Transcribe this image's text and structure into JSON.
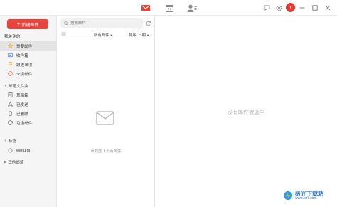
{
  "colors": {
    "accent": "#e5433b",
    "sidebar_bg": "#f5f5f5",
    "active_bg": "#e4e4e4"
  },
  "topbar": {
    "icons": [
      "mail-icon",
      "calendar-icon",
      "contacts-icon",
      "chat-icon",
      "settings-icon",
      "avatar",
      "minimize-icon",
      "maximize-icon",
      "close-icon"
    ],
    "avatar_letter": "Y"
  },
  "sidebar": {
    "compose_label": "新建邮件",
    "favorites_title": "我关注的",
    "favorites": [
      {
        "label": "重要邮件",
        "icon": "star-icon",
        "active": true
      },
      {
        "label": "收件箱",
        "icon": "inbox-icon",
        "active": false
      },
      {
        "label": "跟进事项",
        "icon": "flag-icon",
        "active": false
      },
      {
        "label": "未读邮件",
        "icon": "unread-icon",
        "active": false
      }
    ],
    "folders_title": "邮箱文件夹",
    "folders": [
      {
        "label": "草稿箱",
        "icon": "draft-icon"
      },
      {
        "label": "已发送",
        "icon": "sent-icon"
      },
      {
        "label": "已删除",
        "icon": "trash-icon"
      },
      {
        "label": "垃圾邮件",
        "icon": "spam-icon"
      }
    ],
    "tags_title": "标签",
    "tags": [
      {
        "label": "weifu dj",
        "icon": "tag-icon"
      }
    ],
    "other_title": "其他邮箱"
  },
  "list": {
    "search_placeholder": "搜索邮件",
    "filter_all": "所有邮件",
    "sort_label": "排序:",
    "sort_value": "日期",
    "empty_text": "该视图下没有邮件"
  },
  "pane": {
    "empty_text": "没有邮件被选中"
  },
  "watermark": {
    "text": "极光下载站",
    "url": "www.xz7.com"
  }
}
